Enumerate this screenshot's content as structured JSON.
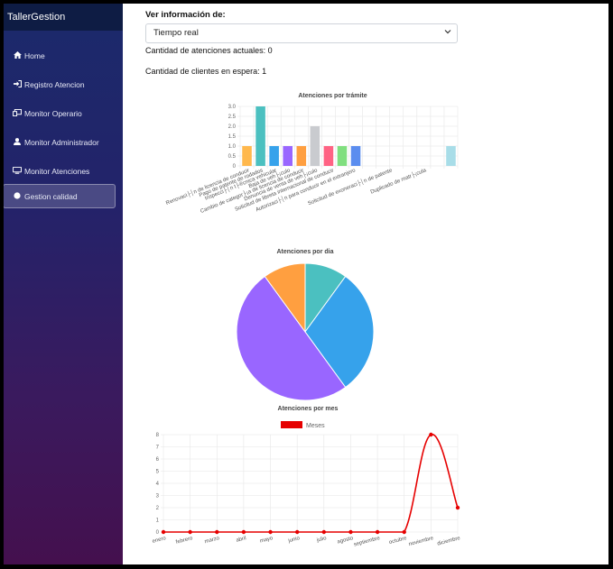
{
  "app": {
    "title": "TallerGestion"
  },
  "sidebar": {
    "items": [
      {
        "label": "Home",
        "icon": "home-icon",
        "active": false
      },
      {
        "label": "Registro Atencion",
        "icon": "sign-in-icon",
        "active": false
      },
      {
        "label": "Monitor Operario",
        "icon": "monitor-operario-icon",
        "active": false
      },
      {
        "label": "Monitor Administrador",
        "icon": "user-icon",
        "active": false
      },
      {
        "label": "Monitor Atenciones",
        "icon": "desktop-icon",
        "active": false
      },
      {
        "label": "Gestion calidad",
        "icon": "circle-icon",
        "active": true
      }
    ]
  },
  "main": {
    "view_label": "Ver información de:",
    "view_select": {
      "value": "Tiempo real"
    },
    "current_attentions": "Cantidad de atenciones actuales: 0",
    "waiting_clients": "Cantidad de clientes en espera: 1"
  },
  "chart_data": [
    {
      "type": "bar",
      "title": "Atenciones por trámite",
      "categories": [
        "Renovaci├│n de licencia de conducir",
        "Pago de patente de rodados",
        "Inspecci├│n t├®cnica vehicular",
        "Baja de veh├¡culo",
        "Cambio de categor├¡a de licencia de conducir",
        "Denuncia de venta de veh├¡culo",
        "Solicitud de libreta internacional de conducir",
        "Autorizaci├│n para conducir en el extranjero",
        "Solicitud de exoneraci├│n de patente",
        "Duplicado de matr├¡cula"
      ],
      "values": [
        1,
        3,
        1,
        1,
        1,
        2,
        1,
        1,
        1,
        0,
        0,
        0,
        0,
        0,
        0,
        1
      ],
      "colors": [
        "#ffb84d",
        "#4bc0c0",
        "#36a2eb",
        "#9966ff",
        "#ff9f40",
        "#c9cbcf",
        "#ff6384",
        "#80df7f",
        "#5b8def",
        "#ffffff",
        "#ffffff",
        "#ffffff",
        "#ffffff",
        "#ffffff",
        "#ffffff",
        "#a8dde8"
      ],
      "ylim": [
        0,
        3
      ],
      "yticks": [
        "0",
        "0.5",
        "1.0",
        "1.5",
        "2.0",
        "2.5",
        "3.0"
      ]
    },
    {
      "type": "pie",
      "title": "Atenciones por dia",
      "values": [
        1,
        3,
        5,
        1
      ],
      "colors": [
        "#4bc0c0",
        "#36a2eb",
        "#9966ff",
        "#ff9f40"
      ]
    },
    {
      "type": "line",
      "title": "Atenciones por mes",
      "legend": "Meses",
      "line_color": "#e60000",
      "categories": [
        "enero",
        "febrero",
        "marzo",
        "abril",
        "mayo",
        "junio",
        "julio",
        "agosto",
        "septiembre",
        "octubre",
        "noviembre",
        "diciembre"
      ],
      "values": [
        0,
        0,
        0,
        0,
        0,
        0,
        0,
        0,
        0,
        0,
        8,
        2
      ],
      "ylim": [
        0,
        8
      ],
      "yticks": [
        "0",
        "1",
        "2",
        "3",
        "4",
        "5",
        "6",
        "7",
        "8"
      ]
    }
  ]
}
